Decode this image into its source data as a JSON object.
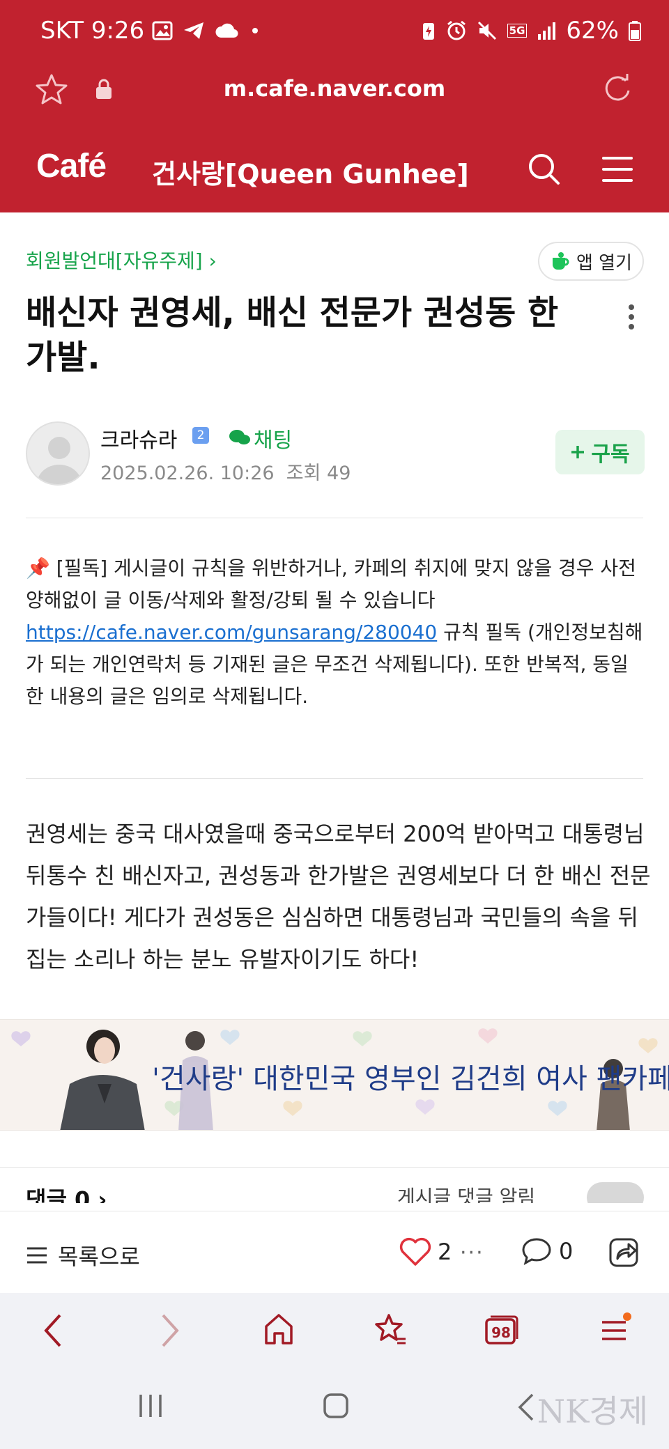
{
  "status_bar": {
    "carrier_time": "SKT 9:26",
    "network": "5G",
    "battery": "62%"
  },
  "browser": {
    "url": "m.cafe.naver.com"
  },
  "cafe": {
    "logo": "Café",
    "name": "건사랑[Queen Gunhee]"
  },
  "post": {
    "board": "회원발언대[자유주제] ›",
    "app_open": "앱 열기",
    "title": "배신자 권영세, 배신 전문가 권성동 한 가발.",
    "author": "크라슈라",
    "level": "2",
    "chat": "채팅",
    "date": "2025.02.26. 10:26",
    "views": "조회 49",
    "subscribe": "구독",
    "notice_pin": "📌",
    "notice_before": "[필독] 게시글이 규칙을 위반하거나, 카페의 취지에 맞지 않을 경우 사전양해없이 글 이동/삭제와 활정/강퇴 될 수 있습니다 ",
    "notice_link": "https://cafe.naver.com/gunsarang/280040",
    "notice_after": " 규칙 필독 (개인정보침해가 되는 개인연락처 등 기재된 글은 무조건 삭제됩니다). 또한 반복적, 동일한 내용의 글은 임의로 삭제됩니다.",
    "body": "권영세는 중국 대사였을때 중국으로부터 200억 받아먹고 대통령님 뒤통수 친 배신자고, 권성동과 한가발은 권영세보다 더 한 배신 전문가들이다! 게다가 권성동은 심심하면 대통령님과 국민들의 속을 뒤집는 소리나 하는 분노 유발자이기도 하다!",
    "banner_text": "'건사랑' 대한민국 영부인 김건희 여사 팬카페"
  },
  "comments": {
    "title": "댓글 0 ›",
    "alert": "게시글 댓글 알림"
  },
  "actions": {
    "list_label": "목록으로",
    "likes": "2",
    "more": "···",
    "comments": "0"
  },
  "browser_nav": {
    "tabs": "98"
  },
  "watermark": "NK경제",
  "colors": {
    "brand_red": "#c1222f",
    "green": "#16a34a",
    "link": "#1a6fd0"
  }
}
